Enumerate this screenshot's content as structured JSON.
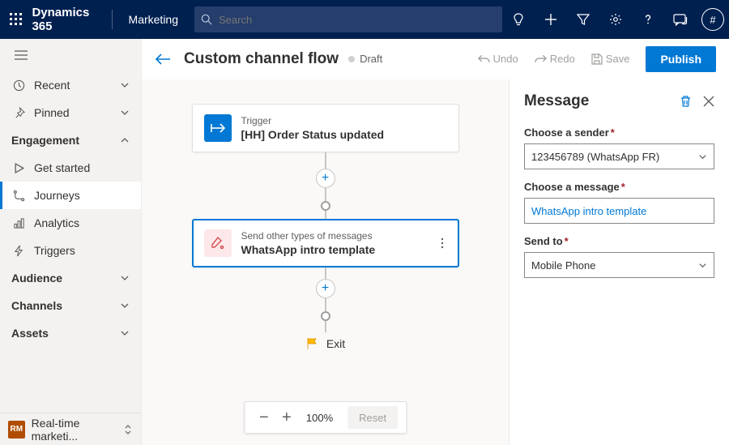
{
  "topbar": {
    "brand": "Dynamics 365",
    "module": "Marketing",
    "search_placeholder": "Search",
    "avatar_char": "#"
  },
  "sidebar": {
    "recent": "Recent",
    "pinned": "Pinned",
    "groups": {
      "engagement": "Engagement",
      "audience": "Audience",
      "channels": "Channels",
      "assets": "Assets"
    },
    "items": {
      "get_started": "Get started",
      "journeys": "Journeys",
      "analytics": "Analytics",
      "triggers": "Triggers"
    },
    "footer": {
      "badge": "RM",
      "label": "Real-time marketi..."
    }
  },
  "cmdbar": {
    "title": "Custom channel flow",
    "status": "Draft",
    "undo": "Undo",
    "redo": "Redo",
    "save": "Save",
    "publish": "Publish"
  },
  "canvas": {
    "trigger": {
      "category": "Trigger",
      "title": "[HH] Order Status updated"
    },
    "message": {
      "category": "Send other types of messages",
      "title": "WhatsApp intro template"
    },
    "exit": "Exit",
    "zoom": {
      "value": "100%",
      "reset": "Reset"
    }
  },
  "panel": {
    "title": "Message",
    "fields": {
      "sender_label": "Choose a sender",
      "sender_value": "123456789 (WhatsApp FR)",
      "message_label": "Choose a message",
      "message_value": "WhatsApp intro template",
      "sendto_label": "Send to",
      "sendto_value": "Mobile Phone"
    }
  }
}
